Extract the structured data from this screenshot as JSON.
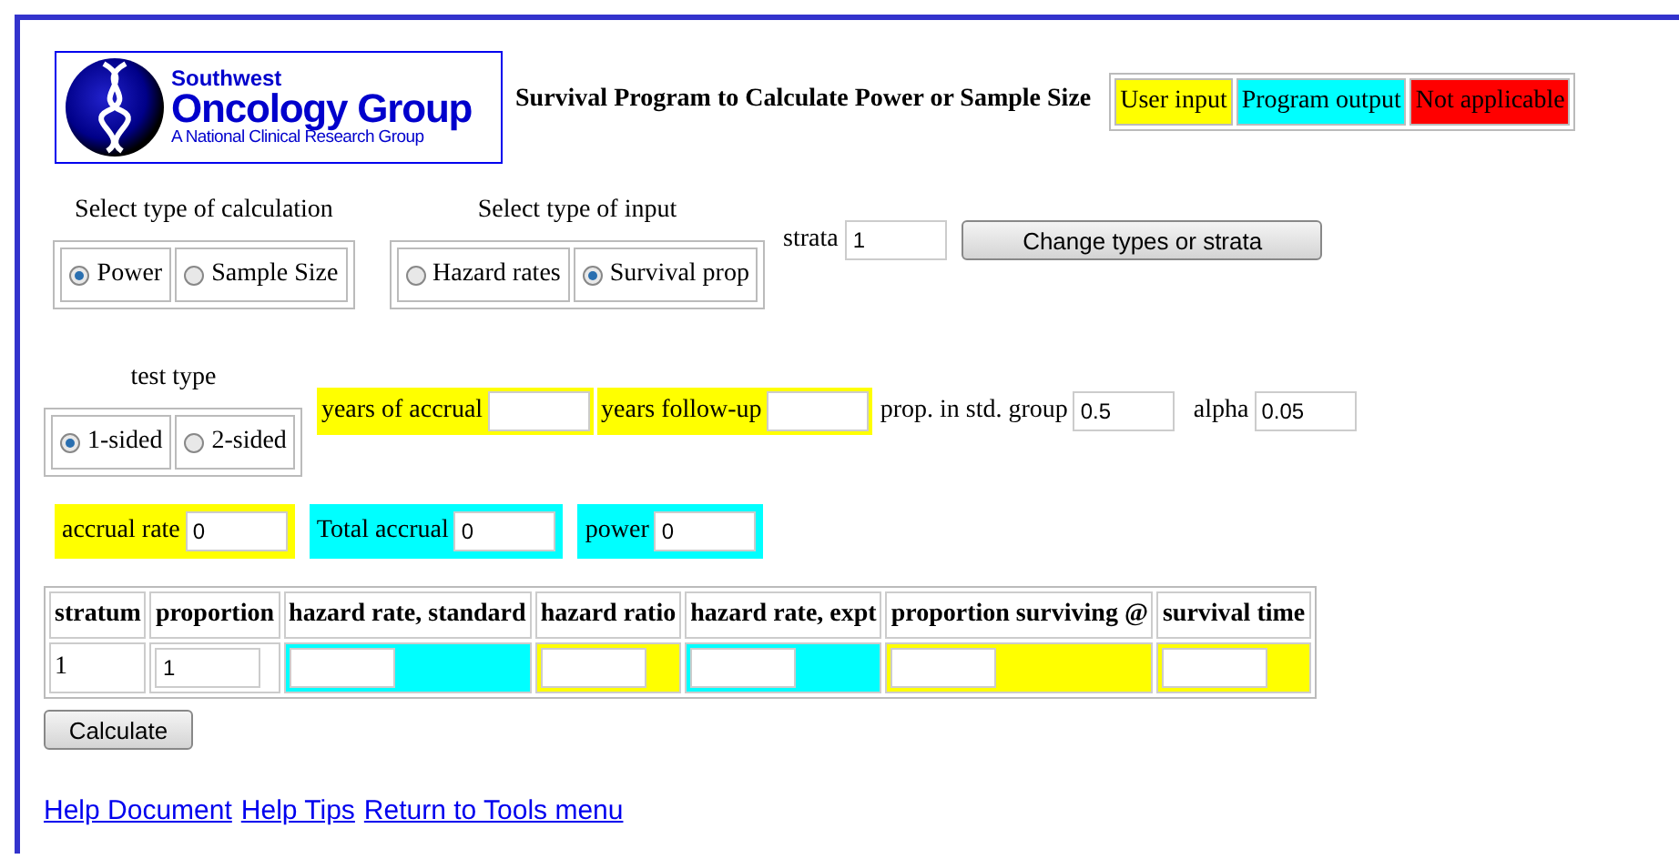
{
  "logo": {
    "line_1": "Southwest",
    "line_2": "Oncology Group",
    "line_3": "A National Clinical Research Group"
  },
  "title": "Survival Program to Calculate Power or Sample Size",
  "legend": [
    {
      "label": "User input",
      "color": "#ffff00"
    },
    {
      "label": "Program output",
      "color": "#00ffff"
    },
    {
      "label": "Not applicable",
      "color": "#ff0000"
    }
  ],
  "calculation_type": {
    "label": "Select type of calculation",
    "options": [
      {
        "label": "Power",
        "selected": true
      },
      {
        "label": "Sample Size",
        "selected": false
      }
    ]
  },
  "input_type": {
    "label": "Select type of input",
    "options": [
      {
        "label": "Hazard rates",
        "selected": false
      },
      {
        "label": "Survival prop",
        "selected": true
      }
    ]
  },
  "strata": {
    "label": "strata",
    "value": "1"
  },
  "change_button": "Change types or strata",
  "test_type": {
    "label": "test type",
    "options": [
      {
        "label": "1-sided",
        "selected": true
      },
      {
        "label": "2-sided",
        "selected": false
      }
    ]
  },
  "parameters": [
    {
      "label": "years of accrual",
      "color": "#ffff00"
    },
    {
      "label": "years follow-up",
      "color": "#ffff00"
    },
    {
      "label": "prop. in std. group",
      "value": "0.5"
    },
    {
      "label": "alpha",
      "value": "0.05"
    }
  ],
  "results": [
    {
      "label": "accrual rate",
      "value": "0",
      "color": "#ffff00"
    },
    {
      "label": "Total accrual",
      "value": "0",
      "color": "#00ffff"
    },
    {
      "label": "power",
      "value": "0",
      "color": "#00ffff"
    }
  ],
  "table": {
    "columns": [
      "stratum",
      "proportion",
      "hazard rate, standard",
      "hazard ratio",
      "hazard rate, expt",
      "proportion surviving @",
      "survival time"
    ],
    "rows": [
      {
        "cells": [
          {
            "kind": "text",
            "text": "1"
          },
          {
            "kind": "input",
            "value": "1"
          },
          {
            "kind": "input",
            "color": "#00ffff"
          },
          {
            "kind": "input",
            "color": "#ffff00"
          },
          {
            "kind": "input",
            "color": "#00ffff"
          },
          {
            "kind": "input",
            "color": "#ffff00"
          },
          {
            "kind": "input",
            "color": "#ffff00"
          }
        ]
      }
    ]
  },
  "calculate_button": "Calculate",
  "links": [
    "Help Document",
    "Help Tips",
    "Return to Tools menu"
  ]
}
